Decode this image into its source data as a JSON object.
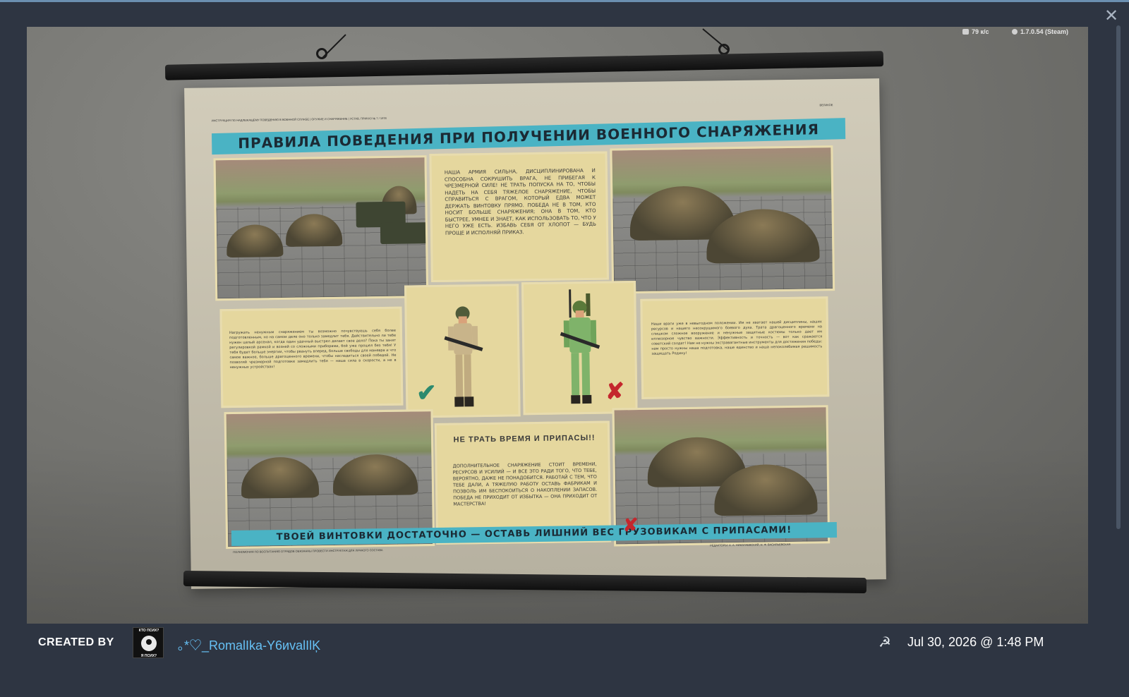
{
  "window": {
    "close_icon": "close-icon"
  },
  "hud": {
    "network_icon": "network-icon",
    "network_speed": "79 к/с",
    "info_icon": "info-icon",
    "version": "1.7.0.54 (Steam)"
  },
  "poster": {
    "tiny_top_left": "ИНСТРУКЦИЯ ПО НАДЛЕЖАЩЕМУ ПОВЕДЕНИЮ В ВОЕННОЙ СЛУЖБЕ | ОРУЖИЕ И СНАРЯЖЕНИЕ | УСТАВ, ПРИКАЗ № 7 / 1978",
    "tiny_top_right": "ВЕЛИКОЕ",
    "title": "ПРАВИЛА ПОВЕДЕНИЯ ПРИ ПОЛУЧЕНИИ ВОЕННОГО СНАРЯЖЕНИЯ",
    "top_center_text": "НАША АРМИЯ СИЛЬНА, ДИСЦИПЛИНИРОВАНА И СПОСОБНА СОКРУШИТЬ ВРАГА, НЕ ПРИБЕГАЯ К ЧРЕЗМЕРНОЙ СИЛЕ! НЕ ТРАТЬ ПОПУСКА НА ТО, ЧТОБЫ НАДЕТЬ НА СЕБЯ ТЯЖЕЛОЕ СНАРЯЖЕНИЕ, ЧТОБЫ СПРАВИТЬСЯ С ВРАГОМ, КОТОРЫЙ ЕДВА МОЖЕТ ДЕРЖАТЬ ВИНТОВКУ ПРЯМО. ПОБЕДА НЕ В ТОМ, КТО НОСИТ БОЛЬШЕ СНАРЯЖЕНИЯ; ОНА В ТОМ, КТО БЫСТРЕЕ, УМНЕЕ И ЗНАЕТ, КАК ИСПОЛЬЗОВАТЬ ТО, ЧТО У НЕГО УЖЕ ЕСТЬ. ИЗБАВЬ СЕБЯ ОТ ХЛОПОТ — БУДЬ ПРОЩЕ И ИСПОЛНЯЙ ПРИКАЗ.",
    "left_text": "Нагружать ненужным снаряжением ты возможно почувствуешь себя более подготовленным, но на самом деле оно только замедлит тебя. Действительно ли тебе нужен целый арсенал, когда один удачный выстрел делает свое дело? Пока ты занят регулировкой рамкой и возней со сложными приборами, бой уже прошел без тебя! У тебя будет больше энергии, чтобы рвануть вперед, больше свободы для маневра и что самое важное, больше драгоценного времени, чтобы насладиться своей победой. Не позволяй чрезмерной подготовке замедлить тебя — наша сила в скорости, а не в ненужных устройствах!",
    "right_text": "Наши враги уже в невыгодном положении. Им не хватает нашей дисциплины, наших ресурсов и нашего несокрушимого боевого духа. Трата драгоценного времени на слишком сложное вооружение и ненужные защитные костюмы только дает им иллюзорное чувство важности. Эффективность и точность — вот как сражается советский солдат! Нам не нужны экстравагантные инструменты для достижения победы: нам просто нужны наша подготовка, наше единство и наша непоколебимая решимость защищать Родину!",
    "bottom_center_heading": "НЕ ТРАТЬ ВРЕМЯ И ПРИПАСЫ!!",
    "bottom_center_text": "ДОПОЛНИТЕЛЬНОЕ СНАРЯЖЕНИЕ СТОИТ ВРЕМЕНИ, РЕСУРСОВ И УСИЛИЙ — И ВСЕ ЭТО РАДИ ТОГО, ЧТО ТЕБЕ, ВЕРОЯТНО, ДАЖЕ НЕ ПОНАДОБИТСЯ. РАБОТАЙ С ТЕМ, ЧТО ТЕБЕ ДАЛИ, А ТЯЖЕЛУЮ РАБОТУ ОСТАВЬ ФАБРИКАМ И ПОЗВОЛЬ ИМ БЕСПОКОИТЬСЯ О НАКОПЛЕНИИ ЗАПАСОВ. ПОБЕДА НЕ ПРИХОДИТ ОТ ИЗБЫТКА — ОНА ПРИХОДИТ ОТ МАСТЕРСТВА!",
    "bottom_banner": "ТВОЕЙ ВИНТОВКИ ДОСТАТОЧНО — ОСТАВЬ ЛИШНИЙ ВЕС ГРУЗОВИКАМ С ПРИПАСАМИ!",
    "tiny_bottom_left": "ПОЛНОМОЧИЯ ПО ВОСПИТАНИЮ ОТРЯДОВ ОБЯЗАННЫ ПРОВЕСТИ ИНСТРУКТАЖ ДЛЯ ЛИЧНОГО СОСТАВА",
    "tiny_bottom_right": "РЕДАКТОРЫ: А. А. НИКОЛАЕВСКИЙ, Н. Ф. ВАСИЛЬЕВСКАЯ",
    "check_mark": "✔",
    "x_mark": "✘"
  },
  "footer": {
    "created_by_label": "CREATED BY",
    "avatar_top_text": "КТО ПСИХ?",
    "avatar_bottom_text": "Я ПСИХ?",
    "username": "｡*♡_RomalIka-Y6иvalIlĶ",
    "app_icon": "game-logo-icon",
    "datetime": "Jul 30, 2026 @ 1:48 PM"
  }
}
